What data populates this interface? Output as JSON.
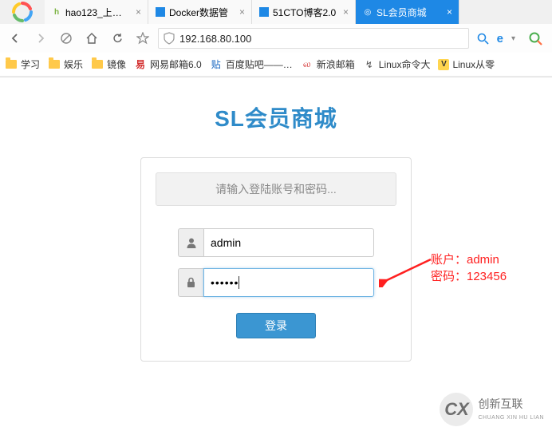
{
  "browser": {
    "tabs": [
      {
        "title": "hao123_上网从",
        "active": false
      },
      {
        "title": "Docker数据管",
        "active": false
      },
      {
        "title": "51CTO博客2.0",
        "active": false
      },
      {
        "title": "SL会员商城",
        "active": true
      }
    ],
    "url": "192.168.80.100"
  },
  "bookmarks": [
    {
      "label": "学习",
      "icon": "folder"
    },
    {
      "label": "娱乐",
      "icon": "folder"
    },
    {
      "label": "镜像",
      "icon": "folder"
    },
    {
      "label": "网易邮箱6.0",
      "icon": "app"
    },
    {
      "label": "百度贴吧——…",
      "icon": "app"
    },
    {
      "label": "新浪邮箱",
      "icon": "app"
    },
    {
      "label": "Linux命令大",
      "icon": "app"
    },
    {
      "label": "Linux从零",
      "icon": "app"
    }
  ],
  "page": {
    "title": "SL会员商城",
    "login_header": "请输入登陆账号和密码...",
    "username_value": "admin",
    "password_value": "••••••",
    "login_button": "登录"
  },
  "annotation": {
    "line1": "账户：admin",
    "line2": "密码：123456"
  },
  "watermark": {
    "logo_text": "CX",
    "text_cn": "创新互联",
    "text_en": "CHUANG XIN HU LIAN"
  }
}
